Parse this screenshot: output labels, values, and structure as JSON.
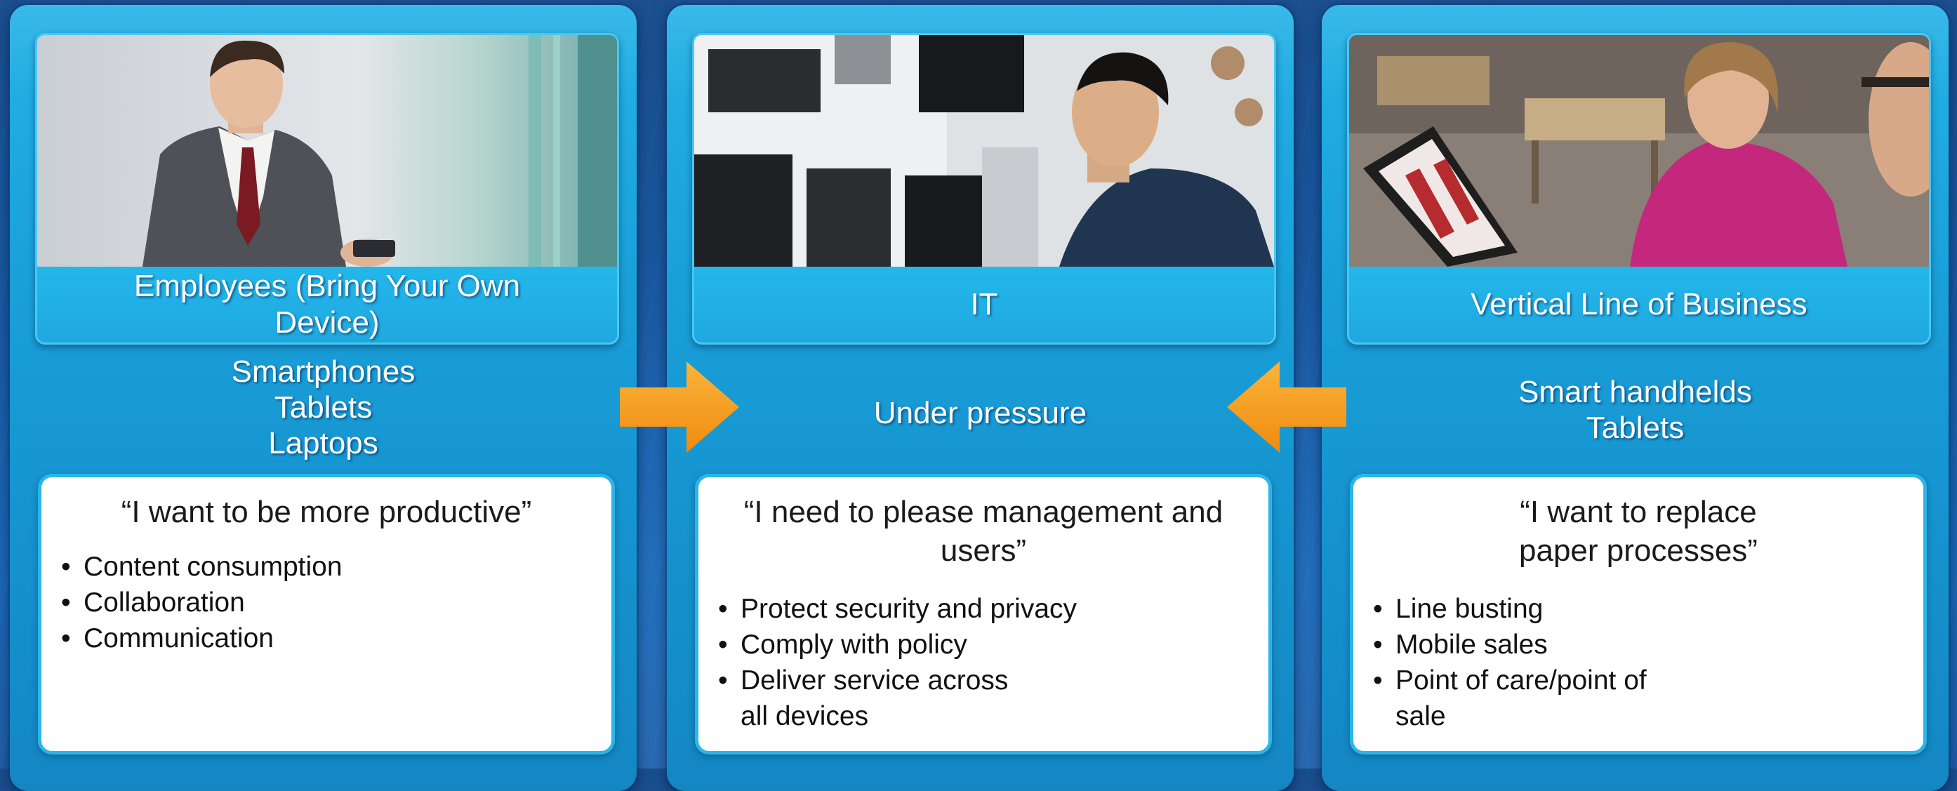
{
  "colors": {
    "background": "#1a5aa3",
    "panel": "#1aa0d9",
    "caption_bar": "#21b0e6",
    "card_border": "#2ab6e8",
    "arrow": "#f7a01d",
    "text_on_blue": "#ffffff",
    "text_on_white": "#111111"
  },
  "panels": [
    {
      "caption": "Employees  (Bring Your Own Device)",
      "devices": [
        "Smartphones",
        "Tablets",
        "Laptops"
      ],
      "quote": "“I want to be more productive”",
      "bullets": [
        "Content consumption",
        "Collaboration",
        "Communication"
      ]
    },
    {
      "caption": "IT",
      "devices": [
        "Under pressure"
      ],
      "quote": "“I need to please management and users”",
      "bullets": [
        "Protect security and privacy",
        "Comply with policy",
        "Deliver service across all devices"
      ]
    },
    {
      "caption": "Vertical Line of Business",
      "devices": [
        "Smart handhelds",
        "Tablets"
      ],
      "quote": "“I want to replace paper processes”",
      "bullets": [
        "Line busting",
        "Mobile sales",
        "Point of care/point of sale"
      ]
    }
  ],
  "arrows": [
    {
      "direction": "right",
      "icon": "arrow-right-icon"
    },
    {
      "direction": "left",
      "icon": "arrow-left-icon"
    }
  ],
  "photos": [
    {
      "icon": "businessman-with-phone-photo"
    },
    {
      "icon": "it-worker-at-server-photo"
    },
    {
      "icon": "woman-with-tablet-photo"
    }
  ]
}
